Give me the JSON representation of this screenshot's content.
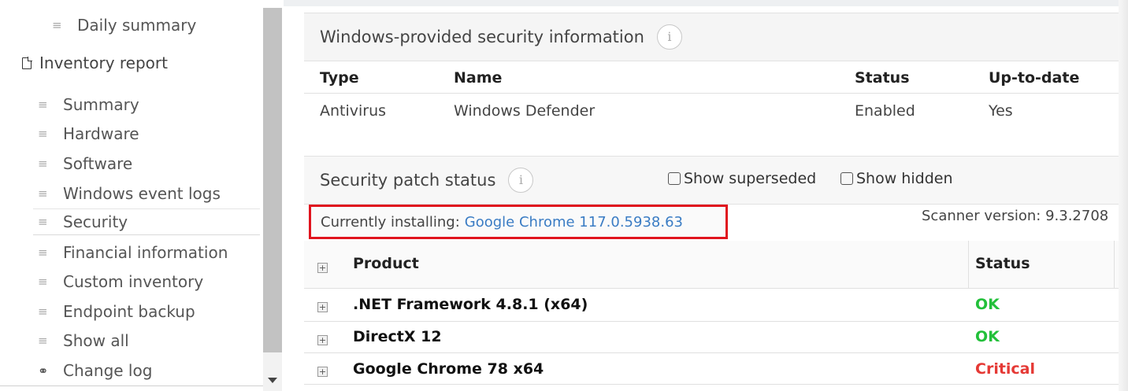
{
  "sidebar": {
    "daily_summary": "Daily summary",
    "inventory_report": "Inventory report",
    "items": [
      {
        "label": "Summary"
      },
      {
        "label": "Hardware"
      },
      {
        "label": "Software"
      },
      {
        "label": "Windows event logs"
      },
      {
        "label": "Security"
      },
      {
        "label": "Financial information"
      },
      {
        "label": "Custom inventory"
      },
      {
        "label": "Endpoint backup"
      },
      {
        "label": "Show all"
      }
    ],
    "change_log": "Change log",
    "selected": "Security",
    "icons": {
      "list": "hamburger-icon",
      "document": "document-icon",
      "link": "link-icon"
    }
  },
  "windows_security": {
    "title": "Windows-provided security information",
    "info_icon": "i",
    "columns": {
      "type": "Type",
      "name": "Name",
      "status": "Status",
      "uptodate": "Up-to-date"
    },
    "row": {
      "type": "Antivirus",
      "name": "Windows Defender",
      "status": "Enabled",
      "uptodate": "Yes"
    }
  },
  "patch_status": {
    "title": "Security patch status",
    "info_icon": "i",
    "show_superseded": "Show superseded",
    "show_hidden": "Show hidden",
    "currently_installing_label": "Currently installing:",
    "currently_installing_value": "Google Chrome 117.0.5938.63",
    "scanner_version": "Scanner version: 9.3.2708",
    "columns": {
      "product": "Product",
      "status": "Status"
    },
    "rows": [
      {
        "product": ".NET Framework 4.8.1 (x64)",
        "status": "OK"
      },
      {
        "product": "DirectX 12",
        "status": "OK"
      },
      {
        "product": "Google Chrome 78 x64",
        "status": "Critical"
      }
    ]
  },
  "colors": {
    "ok": "#22c03a",
    "critical": "#e53935",
    "link": "#3a7cc4",
    "highlight_box": "#e0141e"
  }
}
